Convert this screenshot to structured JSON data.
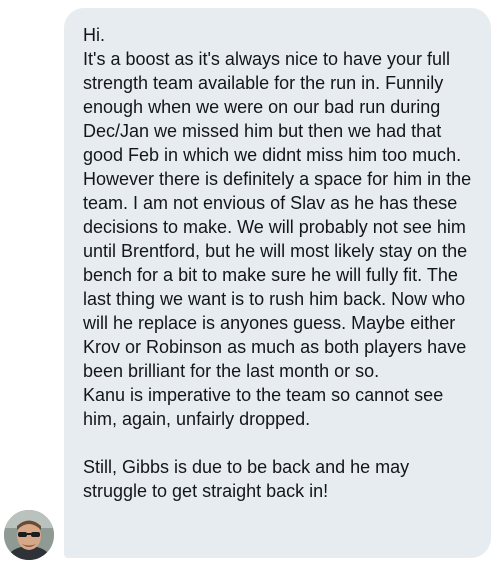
{
  "message": {
    "sender_avatar_icon": "profile-photo-man-sunglasses",
    "bubble_color": "#e6ecf0",
    "text_color": "#14171a",
    "paragraphs": [
      "Hi.",
      "It's a boost as it's always nice to have your full strength team available for the run in. Funnily enough when we were on our bad run during Dec/Jan we missed him but then we had that good Feb in which we didnt miss him too much.",
      "However there is definitely a space for him in the team. I am not envious of Slav as he has these decisions to make. We will probably not see him until Brentford, but he will most likely stay on the bench for a bit to make sure he will fully fit. The last thing we want is to rush him back. Now who will he replace is anyones guess. Maybe either Krov or Robinson as much as both players have been brilliant for the last month or so.",
      "Kanu is imperative to the team so cannot see him, again, unfairly dropped.",
      "Still, Gibbs is due to be back and he may struggle to get straight back in!"
    ]
  }
}
